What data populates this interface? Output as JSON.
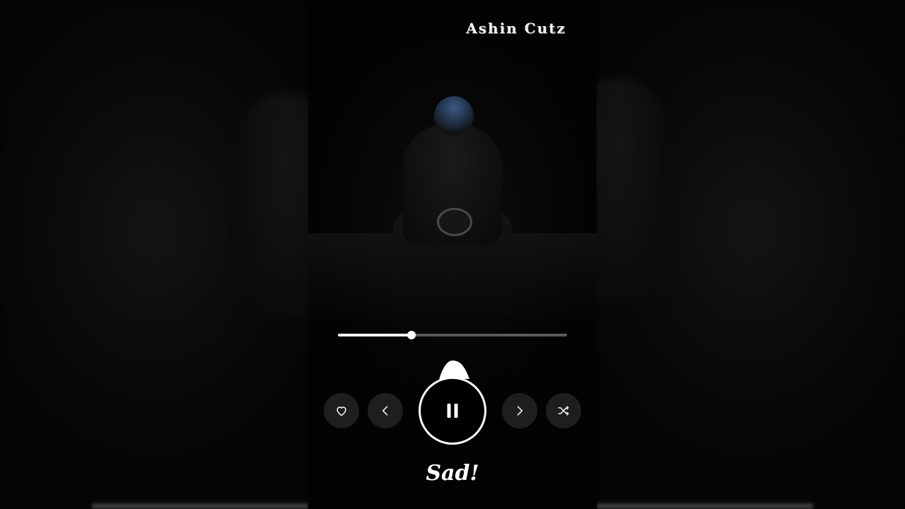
{
  "header": {
    "brand": "Ashin Cutz"
  },
  "player": {
    "progress_fraction": 0.32,
    "state": "playing",
    "track_title": "Sad!",
    "controls": {
      "like_icon": "heart-icon",
      "prev_icon": "chevron-left-icon",
      "pause_icon": "pause-icon",
      "next_icon": "chevron-right-icon",
      "shuffle_icon": "shuffle-icon"
    }
  },
  "colors": {
    "background": "#030303",
    "accent": "#ffffff",
    "control_bg": "#1e1e1e",
    "track_rail": "#5a5a5a"
  }
}
